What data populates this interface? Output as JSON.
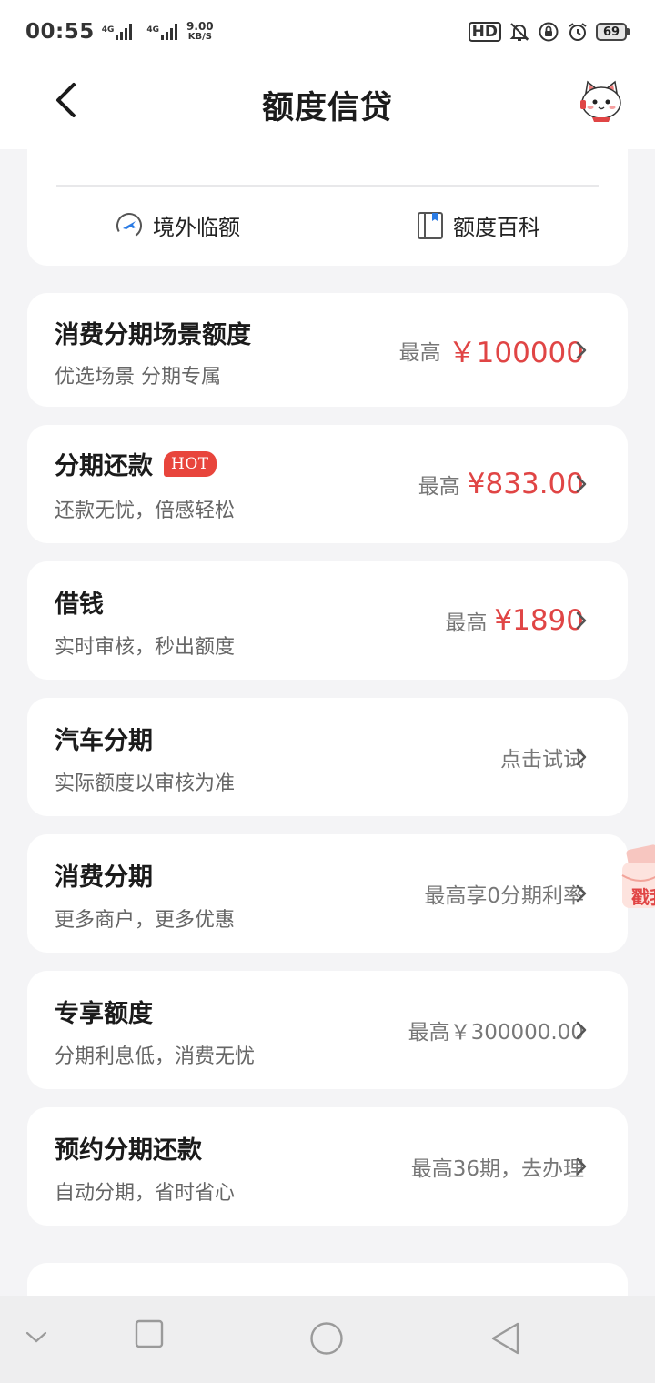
{
  "status_bar": {
    "time": "00:55",
    "signal1_tag": "4G",
    "signal2_tag": "4G",
    "speed_value": "9.00",
    "speed_unit": "KB/S",
    "hd_label": "HD",
    "battery": "69"
  },
  "header": {
    "title": "额度信贷"
  },
  "quick_links": [
    {
      "label": "境外临额",
      "icon": "airplane-icon"
    },
    {
      "label": "额度百科",
      "icon": "book-icon"
    }
  ],
  "cards": [
    {
      "title": "消费分期场景额度",
      "subtitle": "优选场景 分期专属",
      "right_label": "最高",
      "amount": "￥100000",
      "badge": ""
    },
    {
      "title": "分期还款",
      "subtitle": "还款无忧，倍感轻松",
      "right_label": "最高",
      "amount": "¥833.00",
      "badge": "HOT"
    },
    {
      "title": "借钱",
      "subtitle": "实时审核，秒出额度",
      "right_label": "最高",
      "amount": "¥1890",
      "badge": ""
    },
    {
      "title": "汽车分期",
      "subtitle": "实际额度以审核为准",
      "right_text": "点击试试"
    },
    {
      "title": "消费分期",
      "subtitle": "更多商户，更多优惠",
      "right_text": "最高享0分期利率"
    },
    {
      "title": "专享额度",
      "subtitle": "分期利息低，消费无忧",
      "right_text": "最高￥300000.00"
    },
    {
      "title": "预约分期还款",
      "subtitle": "自动分期，省时省心",
      "right_text": "最高36期，去办理"
    }
  ],
  "float_promo": {
    "text": "戳我"
  },
  "colors": {
    "accent_red": "#e04545",
    "hot_badge": "#e8453c",
    "background": "#f4f4f6",
    "card": "#ffffff"
  }
}
